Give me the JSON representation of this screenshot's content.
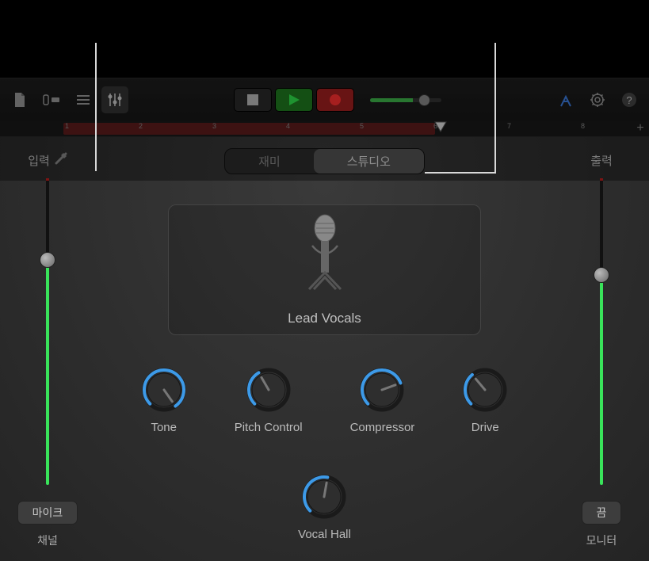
{
  "toolbar": {
    "icons": [
      "document-icon",
      "track-view-icon",
      "list-icon",
      "mixer-icon"
    ],
    "right_icons": [
      "tuning-fork-icon",
      "settings-icon",
      "help-icon"
    ]
  },
  "ruler": {
    "markers": [
      "1",
      "2",
      "3",
      "4",
      "5",
      "6",
      "7",
      "8"
    ],
    "playhead_pos": "6",
    "add_label": "+"
  },
  "input": {
    "label": "입력",
    "button": "마이크",
    "sublabel": "채널",
    "fader_pct": 75
  },
  "output": {
    "label": "출력",
    "button": "끔",
    "sublabel": "모니터",
    "fader_pct": 70
  },
  "segment": {
    "left": "재미",
    "right": "스튜디오"
  },
  "patch": {
    "name": "Lead Vocals"
  },
  "knobs": [
    {
      "label": "Tone",
      "angle": 55
    },
    {
      "label": "Pitch Control",
      "angle": -120
    },
    {
      "label": "Compressor",
      "angle": -20
    },
    {
      "label": "Drive",
      "angle": -130
    },
    {
      "label": "Vocal Hall",
      "angle": -80
    }
  ]
}
